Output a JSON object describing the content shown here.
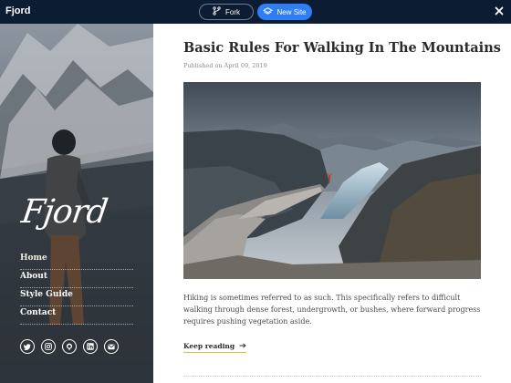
{
  "topbar": {
    "brand": "Fjord",
    "fork_label": "Fork",
    "new_site_label": "New Site",
    "fork_icon": "git-fork-icon",
    "new_site_icon": "layers-icon",
    "close_icon": "close-icon",
    "colors": {
      "background": "#0c1c33",
      "accent": "#2f7ef5"
    }
  },
  "sidebar": {
    "logo_text": "Fjord",
    "nav": [
      {
        "label": "Home",
        "active": true
      },
      {
        "label": "About",
        "active": false
      },
      {
        "label": "Style Guide",
        "active": false
      },
      {
        "label": "Contact",
        "active": false
      }
    ],
    "social_icons": [
      "twitter-icon",
      "instagram-icon",
      "github-icon",
      "linkedin-icon",
      "email-icon"
    ]
  },
  "post": {
    "title": "Basic Rules For Walking In The Mountains",
    "date": "Published on April 09, 2019",
    "excerpt": "Hiking is sometimes referred to as such. This specifically refers to difficult walking through dense forest, undergrowth, or bushes, where forward progress requires pushing vegetation aside.",
    "read_more": "Keep reading",
    "read_more_icon": "arrow-right-icon",
    "colors": {
      "link_underline": "#e6b93a",
      "title": "#2b2b2b"
    }
  }
}
